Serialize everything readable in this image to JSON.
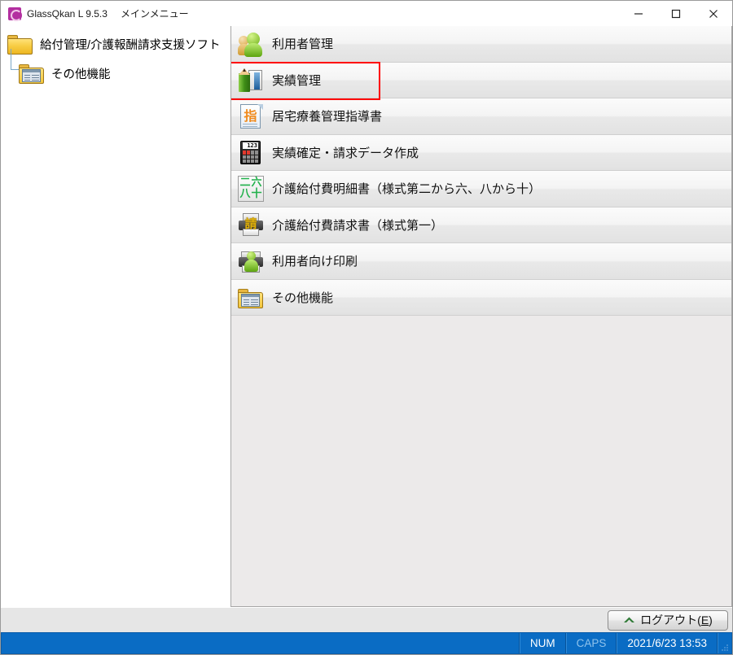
{
  "window": {
    "app_title": "GlassQkan L 9.5.3",
    "screen_title": "メインメニュー",
    "app_icon": "glassqkan-logo-icon",
    "controls": {
      "minimize": "minimize-icon",
      "maximize": "maximize-icon",
      "close": "close-icon"
    }
  },
  "tree": {
    "items": [
      {
        "label": "給付管理/介護報酬請求支援ソフト",
        "icon": "folder-icon",
        "level": 0
      },
      {
        "label": "その他機能",
        "icon": "list-folder-icon",
        "level": 1
      }
    ]
  },
  "menu": {
    "selected_index": 1,
    "items": [
      {
        "label": "利用者管理",
        "icon": "users-icon"
      },
      {
        "label": "実績管理",
        "icon": "pencil-book-icon"
      },
      {
        "label": "居宅療養管理指導書",
        "icon": "document-shi-icon"
      },
      {
        "label": "実績確定・請求データ作成",
        "icon": "calculator-icon"
      },
      {
        "label": "介護給付費明細書（様式第二から六、八から十）",
        "icon": "kanji-grid-icon"
      },
      {
        "label": "介護給付費請求書（様式第一）",
        "icon": "printer-sei-icon"
      },
      {
        "label": "利用者向け印刷",
        "icon": "printer-person-icon"
      },
      {
        "label": "その他機能",
        "icon": "list-folder-icon"
      }
    ]
  },
  "icon_glyphs": {
    "calculator_screen": "123",
    "document_kanji": "指",
    "printer_kanji": "請",
    "kanji_grid": [
      "二",
      "六",
      "八",
      "十"
    ]
  },
  "footer": {
    "logout_label_prefix": "ログアウト(",
    "logout_accel": "E",
    "logout_label_suffix": ")",
    "logout_icon": "logout-arrow-icon"
  },
  "statusbar": {
    "num_label": "NUM",
    "caps_label": "CAPS",
    "datetime": "2021/6/23 13:53",
    "grip": "resize-grip-icon"
  },
  "colors": {
    "accent_blue": "#0a6cc4",
    "selection_red": "#ff0000",
    "folder_yellow": "#f3c63c",
    "person_green": "#6fb317",
    "title_purple": "#b32fa0"
  }
}
